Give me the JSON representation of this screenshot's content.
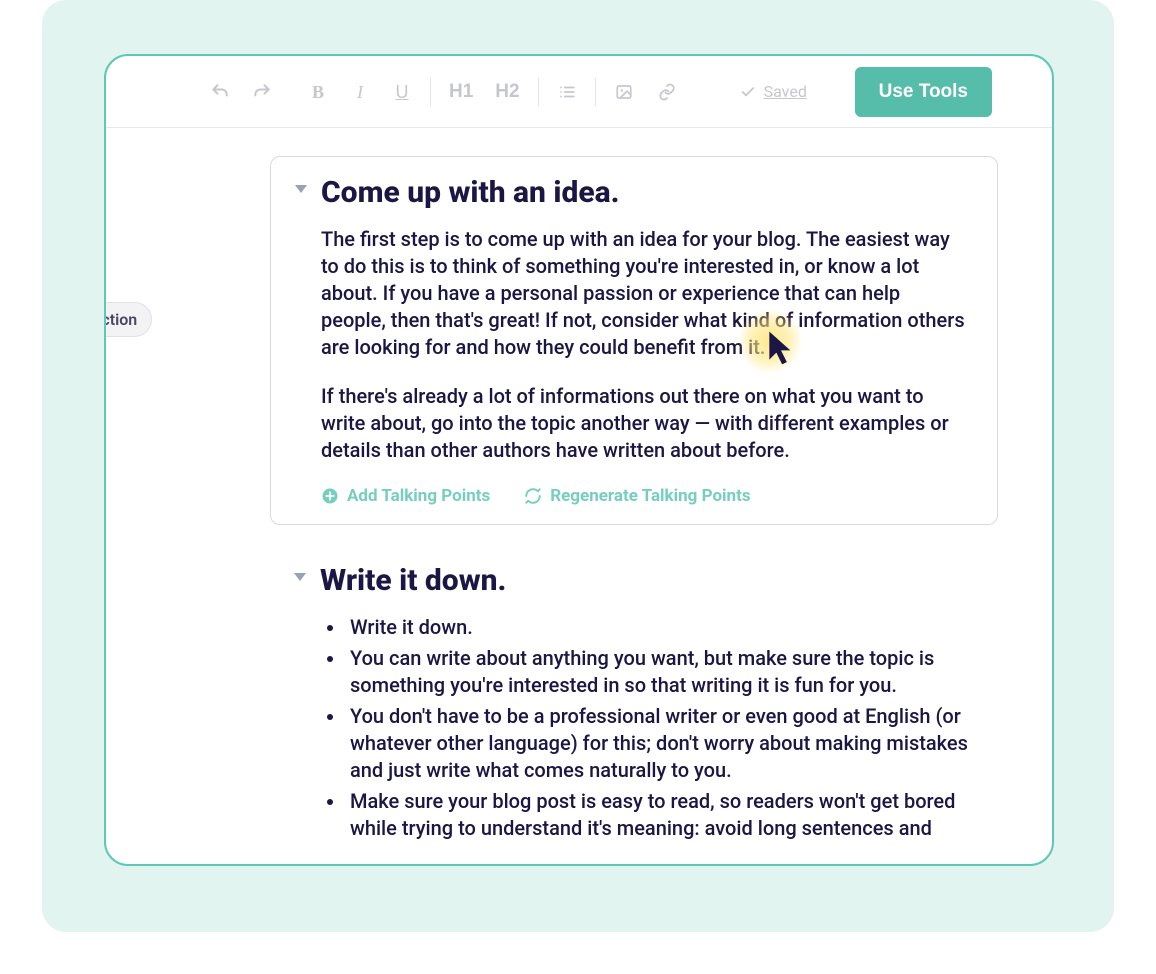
{
  "toolbar": {
    "h1": "H1",
    "h2": "H2",
    "saved_label": "Saved",
    "use_tools_label": "Use Tools"
  },
  "section_pill": "Section",
  "sections": [
    {
      "title": "Come up with an idea.",
      "paragraphs": [
        "The first step is to come up with an idea for your blog. The easiest way to do this is to think of something you're interested in, or know a lot about. If you have a personal passion or experience that can help people, then that's great! If not, consider what kind of information others are looking for and how they could benefit from it.",
        "If there's already a lot of informations out there on what you want to write about, go into the topic another way — with different examples or details than other authors have written about before."
      ],
      "actions": {
        "add": "Add Talking Points",
        "regen": "Regenerate Talking Points"
      }
    },
    {
      "title": "Write it down.",
      "bullets": [
        "Write it down.",
        "You can write about anything you want, but make sure the topic is  something you're interested in so that writing it is fun for you.",
        "You don't have to be a professional writer or even good at English (or whatever other language) for this; don't worry about making mistakes and just write what comes naturally to you.",
        "Make sure your blog post is easy to read, so readers won't get bored while trying to understand it's meaning: avoid long sentences and"
      ]
    }
  ]
}
